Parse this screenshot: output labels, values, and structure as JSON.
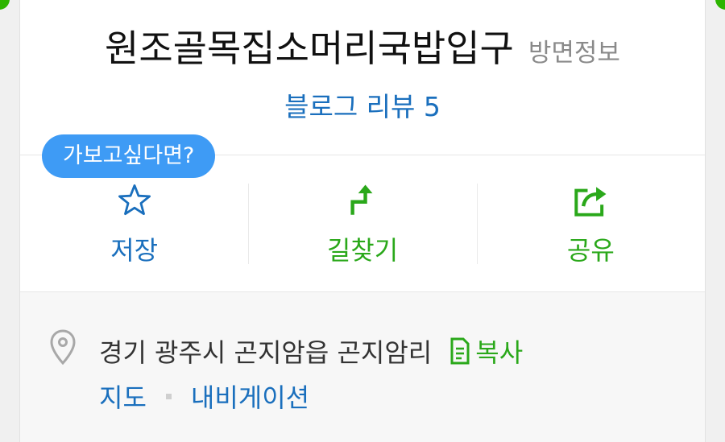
{
  "place": {
    "name": "원조골목집소머리국밥입구",
    "category": "방면정보",
    "blog_review_label": "블로그 리뷰 5"
  },
  "tooltip": {
    "text": "가보고싶다면?"
  },
  "actions": {
    "save": {
      "label": "저장",
      "icon": "star-outline-icon"
    },
    "directions": {
      "label": "길찾기",
      "icon": "route-arrow-icon"
    },
    "share": {
      "label": "공유",
      "icon": "share-arrow-icon"
    }
  },
  "info": {
    "address": "경기 광주시 곤지암읍 곤지암리",
    "copy_label": "복사",
    "map_link": "지도",
    "navigation_link": "내비게이션"
  },
  "colors": {
    "brand_green": "#2aa81a",
    "link_blue": "#1a6fbd",
    "tooltip_blue": "#3e9bf5"
  }
}
